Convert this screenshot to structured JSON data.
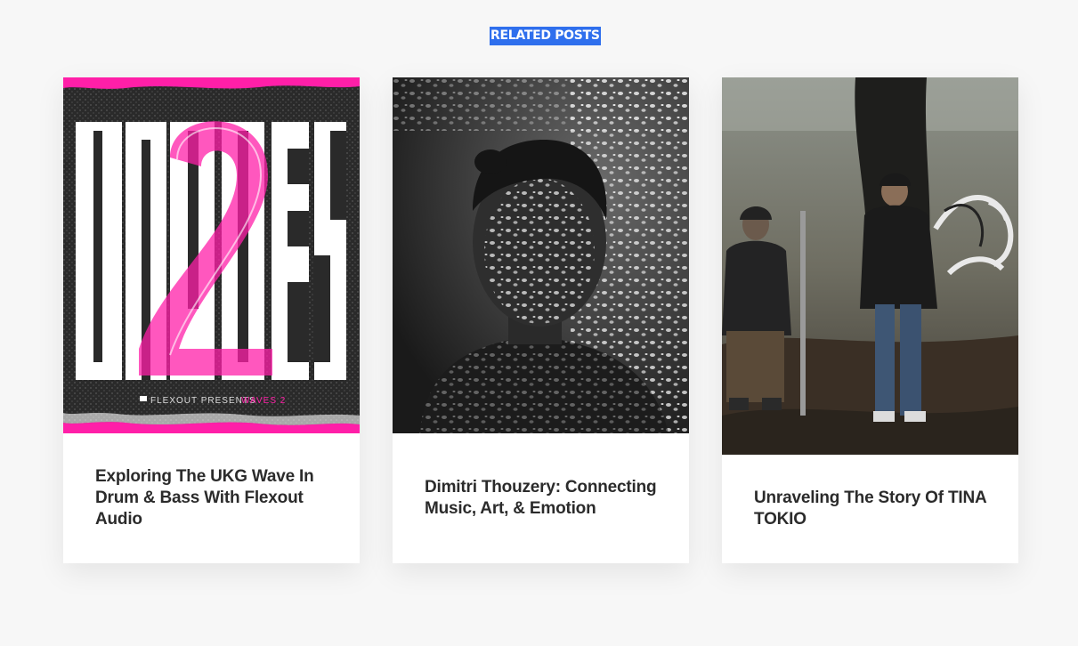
{
  "section": {
    "heading": "RELATED POSTS"
  },
  "posts": [
    {
      "title": "Exploring The UKG Wave In Drum & Bass With Flexout Audio",
      "image_icon": "album-cover-waves-2",
      "cover_text": "WAVES",
      "cover_number": "2",
      "cover_footer": "FLEXOUT PRESENTS WAVES 2"
    },
    {
      "title": "Dimitri Thouzery: Connecting Music, Art, & Emotion",
      "image_icon": "portrait-photo-bw"
    },
    {
      "title": "Unraveling The Story Of TINA TOKIO",
      "image_icon": "duo-photo-graffiti-wall"
    }
  ],
  "colors": {
    "background": "#f7f7f7",
    "heading_highlight": "#2f6fed",
    "accent_pink": "#ff1fa8",
    "title_text": "#2b2b2b"
  }
}
